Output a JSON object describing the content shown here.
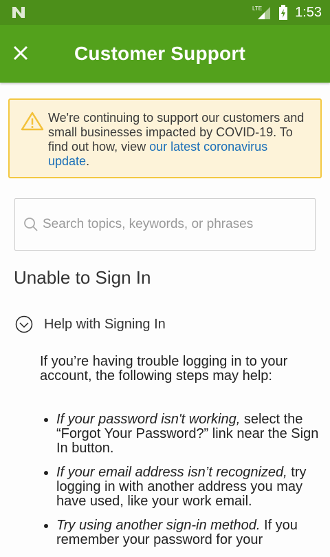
{
  "status_bar": {
    "time": "1:53",
    "network": "LTE"
  },
  "app_bar": {
    "title": "Customer Support"
  },
  "alert": {
    "text": "We're continuing to support our customers and small businesses impacted by COVID-19. To find out how, view ",
    "link": "our latest coronavirus update",
    "end": "."
  },
  "search": {
    "placeholder": "Search topics, keywords, or phrases"
  },
  "section_title": "Unable to Sign In",
  "accordion": {
    "label": "Help with Signing In"
  },
  "content": {
    "intro": "If you’re having trouble logging in to your account, the following steps may help:",
    "bullets": [
      {
        "em": "If your password isn't working,",
        "text": " select the “Forgot Your Password?” link near the Sign In button."
      },
      {
        "em": "If your email address isn’t recognized,",
        "text": " try logging in with another address you may have used, like your work email."
      },
      {
        "em": "Try using another sign-in method.",
        "text": " If you remember your password for your"
      }
    ]
  },
  "colors": {
    "status": "#4c8f1a",
    "appbar": "#53a11c",
    "alert_bg": "#fdf3d9",
    "alert_border": "#f3c842",
    "link": "#1b6fb8"
  }
}
